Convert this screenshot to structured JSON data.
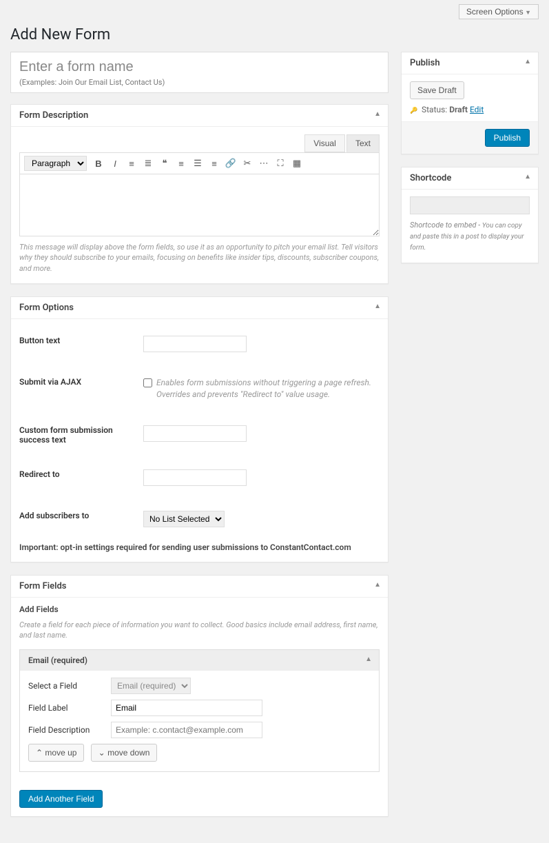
{
  "screen_options": "Screen Options",
  "page_title": "Add New Form",
  "title_placeholder": "Enter a form name",
  "title_hint": "(Examples: Join Our Email List, Contact Us)",
  "description": {
    "title": "Form Description",
    "tab_visual": "Visual",
    "tab_text": "Text",
    "paragraph": "Paragraph",
    "help": "This message will display above the form fields, so use it as an opportunity to pitch your email list. Tell visitors why they should subscribe to your emails, focusing on benefits like insider tips, discounts, subscriber coupons, and more."
  },
  "options": {
    "title": "Form Options",
    "button_text": "Button text",
    "ajax_label": "Submit via AJAX",
    "ajax_help": "Enables form submissions without triggering a page refresh. Overrides and prevents \"Redirect to\" value usage.",
    "success_text": "Custom form submission success text",
    "redirect": "Redirect to",
    "subscribers": "Add subscribers to",
    "no_list": "No List Selected",
    "important": "Important: opt-in settings required for sending user submissions to ConstantContact.com"
  },
  "fields": {
    "title": "Form Fields",
    "add_title": "Add Fields",
    "add_help": "Create a field for each piece of information you want to collect. Good basics include email address, first name, and last name.",
    "email_title": "Email (required)",
    "select_field": "Select a Field",
    "email_option": "Email (required)",
    "label_label": "Field Label",
    "label_value": "Email",
    "desc_label": "Field Description",
    "desc_placeholder": "Example: c.contact@example.com",
    "move_up": "move up",
    "move_down": "move down",
    "add_another": "Add Another Field"
  },
  "publish": {
    "title": "Publish",
    "save_draft": "Save Draft",
    "status_label": "Status:",
    "status_value": "Draft",
    "edit": "Edit",
    "publish_btn": "Publish"
  },
  "shortcode": {
    "title": "Shortcode",
    "help_prefix": "Shortcode to embed - ",
    "help_rest": "You can copy and paste this in a post to display your form."
  }
}
